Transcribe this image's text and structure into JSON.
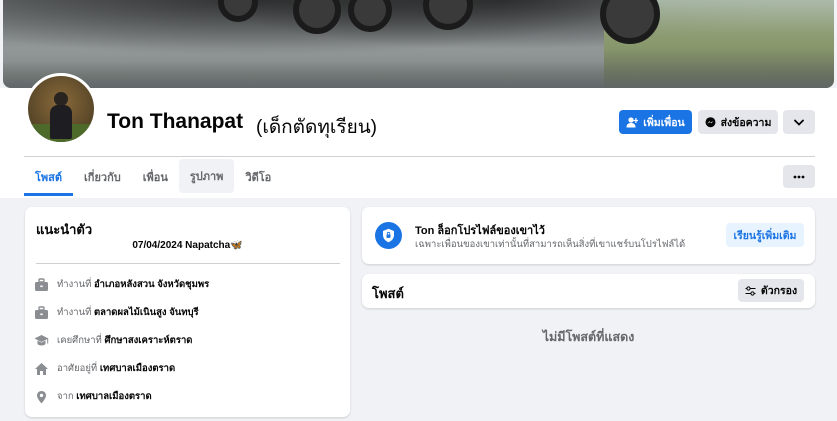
{
  "profile": {
    "name": "Ton Thanapat",
    "nickname": "(เด็กตัดทุเรียน)"
  },
  "actions": {
    "add_friend": "เพิ่มเพื่อน",
    "message": "ส่งข้อความ"
  },
  "tabs": [
    {
      "label": "โพสต์",
      "active": true
    },
    {
      "label": "เกี่ยวกับ"
    },
    {
      "label": "เพื่อน"
    },
    {
      "label": "รูปภาพ"
    },
    {
      "label": "วิดีโอ"
    }
  ],
  "intro": {
    "title": "แนะนำตัว",
    "bio": "07/04/2024 Napatcha",
    "bio_emoji": "🦋",
    "items": [
      {
        "icon": "briefcase-icon",
        "prefix": "ทำงานที่",
        "value": "อำเภอหลังสวน จังหวัดชุมพร"
      },
      {
        "icon": "briefcase-icon",
        "prefix": "ทำงานที่",
        "value": "ตลาดผลไม้เนินสูง จันทบุรี"
      },
      {
        "icon": "graduation-cap-icon",
        "prefix": "เคยศึกษาที่",
        "value": "ศึกษาสงเคราะห์ตราด"
      },
      {
        "icon": "home-icon",
        "prefix": "อาศัยอยู่ที่",
        "value": "เทศบาลเมืองตราด"
      },
      {
        "icon": "location-pin-icon",
        "prefix": "จาก",
        "value": "เทศบาลเมืองตราด"
      }
    ]
  },
  "locked": {
    "title": "Ton ล็อกโปรไฟล์ของเขาไว้",
    "subtitle": "เฉพาะเพื่อนของเขาเท่านั้นที่สามารถเห็นสิ่งที่เขาแชร์บนโปรไฟล์ได้",
    "learn_more": "เรียนรู้เพิ่มเติม"
  },
  "posts": {
    "title": "โพสต์",
    "filter": "ตัวกรอง",
    "empty": "ไม่มีโพสต์ที่แสดง"
  },
  "colors": {
    "accent": "#1b74e4",
    "page_bg": "#f0f2f5"
  }
}
